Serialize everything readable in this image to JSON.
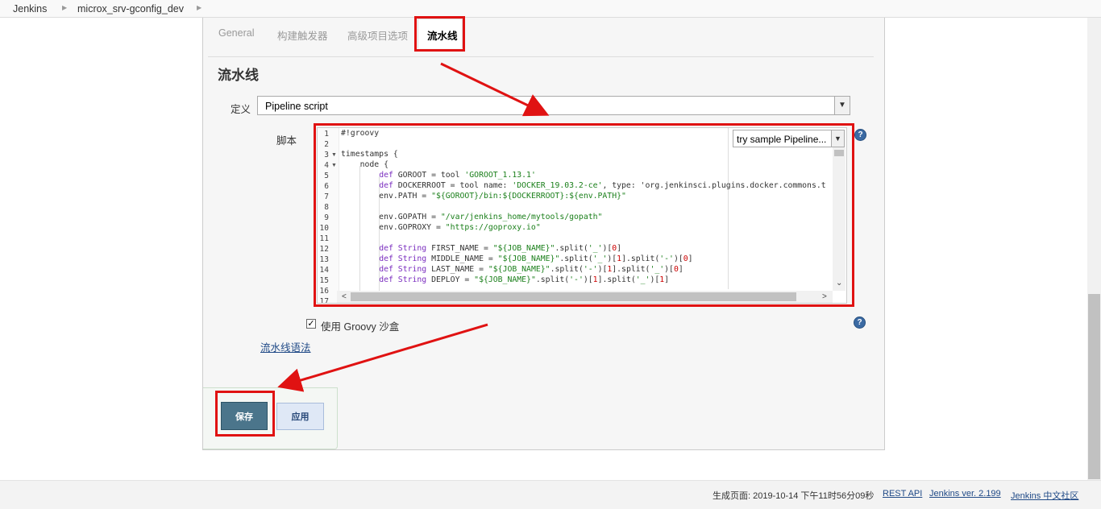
{
  "breadcrumb": {
    "items": [
      "Jenkins",
      "microx_srv-gconfig_dev"
    ]
  },
  "tabs": [
    {
      "label": "General"
    },
    {
      "label": "构建触发器"
    },
    {
      "label": "高级项目选项"
    },
    {
      "label": "流水线"
    }
  ],
  "section": {
    "title": "流水线",
    "definition_label": "定义",
    "definition_value": "Pipeline script",
    "script_label": "脚本",
    "sample_select": "try sample Pipeline...",
    "sandbox_label": "使用 Groovy 沙盒",
    "syntax_link": "流水线语法"
  },
  "editor": {
    "line_numbers": [
      "1",
      "2",
      "3",
      "4",
      "5",
      "6",
      "7",
      "8",
      "9",
      "10",
      "11",
      "12",
      "13",
      "14",
      "15",
      "16",
      "17"
    ],
    "lines": [
      "#!groovy",
      "",
      "timestamps {",
      "    node {",
      "        def GOROOT = tool 'GOROOT_1.13.1'",
      "        def DOCKERROOT = tool name: 'DOCKER_19.03.2-ce', type: 'org.jenkinsci.plugins.docker.commons.t",
      "        env.PATH = \"${GOROOT}/bin:${DOCKERROOT}:${env.PATH}\"",
      "",
      "        env.GOPATH = \"/var/jenkins_home/mytools/gopath\"",
      "        env.GOPROXY = \"https://goproxy.io\"",
      "",
      "        def String FIRST_NAME = \"${JOB_NAME}\".split('_')[0]",
      "        def String MIDDLE_NAME = \"${JOB_NAME}\".split('_')[1].split('-')[0]",
      "        def String LAST_NAME = \"${JOB_NAME}\".split('-')[1].split('_')[0]",
      "        def String DEPLOY = \"${JOB_NAME}\".split('-')[1].split('_')[1]",
      "",
      ""
    ]
  },
  "buttons": {
    "save": "保存",
    "apply": "应用"
  },
  "footer": {
    "generated": "生成页面: 2019-10-14 下午11时56分09秒",
    "rest_api": "REST API",
    "version": "Jenkins ver. 2.199",
    "community": "Jenkins 中文社区"
  },
  "colors": {
    "highlight": "#e01212",
    "save_button": "#4b758b",
    "link": "#204a87"
  },
  "icons": {
    "help": "help-icon",
    "checkbox": "checkbox-checked",
    "dropdown": "chevron-down-icon"
  }
}
